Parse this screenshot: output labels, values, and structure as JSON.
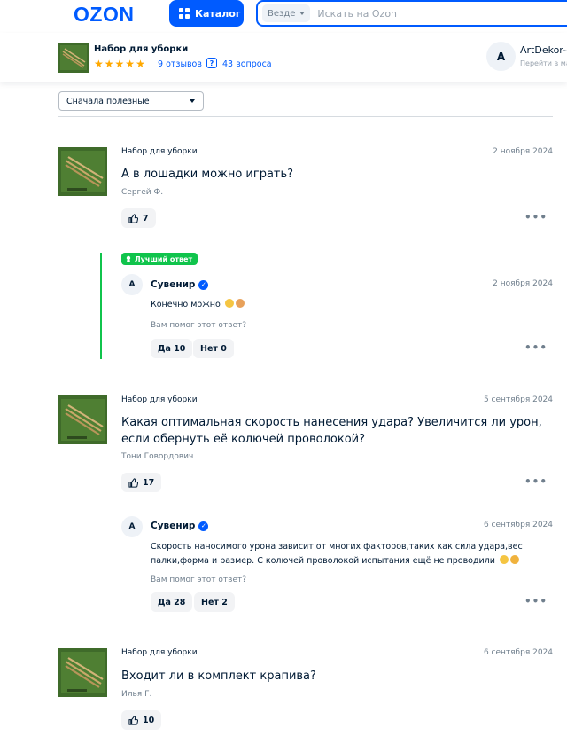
{
  "header": {
    "logo": "OZON",
    "catalog_label": "Каталог",
    "search_scope": "Везде",
    "search_placeholder": "Искать на Ozon"
  },
  "product": {
    "name": "Набор для уборки",
    "rating_stars": 5,
    "reviews_label": "9 отзывов",
    "questions_label": "43 вопроса",
    "seller_initial": "A",
    "seller_name": "ArtDekor-—",
    "seller_sub": "Перейти в ма"
  },
  "sort": {
    "selected": "Сначала полезные"
  },
  "questions": [
    {
      "tag": "Набор для уборки",
      "date": "2 ноября 2024",
      "text": "А в лошадки можно играть?",
      "author": "Сергей Ф.",
      "likes": "7",
      "answer": {
        "best_label": "Лучший ответ",
        "avatar": "A",
        "name": "Сувенир",
        "date": "2 ноября 2024",
        "text": "Конечно можно",
        "helpful": "Вам помог этот ответ?",
        "yes": "Да 10",
        "no": "Нет 0"
      }
    },
    {
      "tag": "Набор для уборки",
      "date": "5 сентября 2024",
      "text": "Какая оптимальная скорость нанесения удара? Увеличится ли урон, если обернуть её колючей проволокой?",
      "author": "Тони Говордович",
      "likes": "17",
      "answer": {
        "avatar": "A",
        "name": "Сувенир",
        "date": "6 сентября 2024",
        "text": "Скорость наносимого урона зависит от многих факторов,таких как сила удара,вес палки,форма и размер. С колючей проволокой испытания ещё не проводили",
        "helpful": "Вам помог этот ответ?",
        "yes": "Да 28",
        "no": "Нет 2"
      }
    },
    {
      "tag": "Набор для уборки",
      "date": "6 сентября 2024",
      "text": "Входит ли в комплект крапива?",
      "author": "Илья Г.",
      "likes": "10"
    }
  ],
  "colors": {
    "brand": "#005bff",
    "best": "#10c44c",
    "star": "#ffa800",
    "muted": "#707f8d"
  }
}
